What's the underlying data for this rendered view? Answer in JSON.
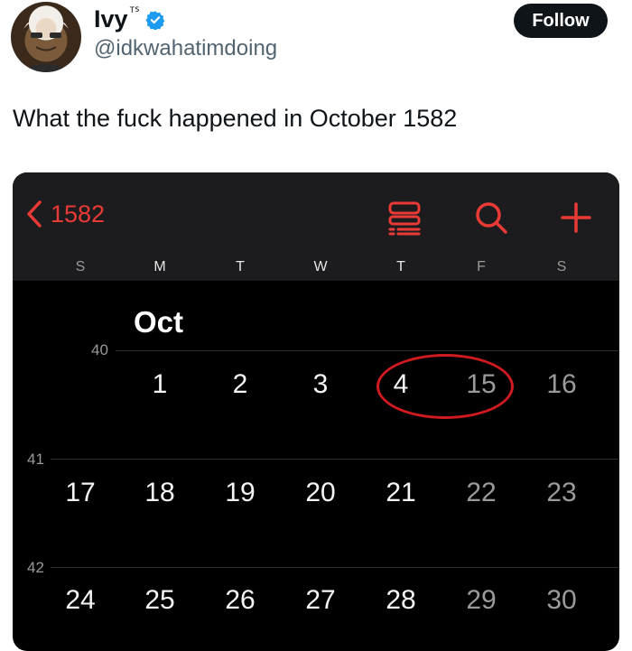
{
  "tweet": {
    "author_name": "Ivy",
    "author_name_suffix": "ᵀᔆ",
    "handle": "@idkwahatimdoing",
    "follow_label": "Follow",
    "text": "What the fuck happened in October 1582"
  },
  "calendar": {
    "year_label": "1582",
    "weekdays": [
      "S",
      "M",
      "T",
      "W",
      "T",
      "F",
      "S"
    ],
    "month_label": "Oct",
    "weeks": [
      {
        "number": "40",
        "days": [
          "",
          "1",
          "2",
          "3",
          "4",
          "15",
          "16"
        ]
      },
      {
        "number": "41",
        "days": [
          "17",
          "18",
          "19",
          "20",
          "21",
          "22",
          "23"
        ]
      },
      {
        "number": "42",
        "days": [
          "24",
          "25",
          "26",
          "27",
          "28",
          "29",
          "30"
        ]
      }
    ],
    "accent_color": "#ea3a35",
    "circle_color": "#d11a1f",
    "icons": [
      "chevron-left-icon",
      "list-view-icon",
      "search-icon",
      "add-icon"
    ]
  }
}
